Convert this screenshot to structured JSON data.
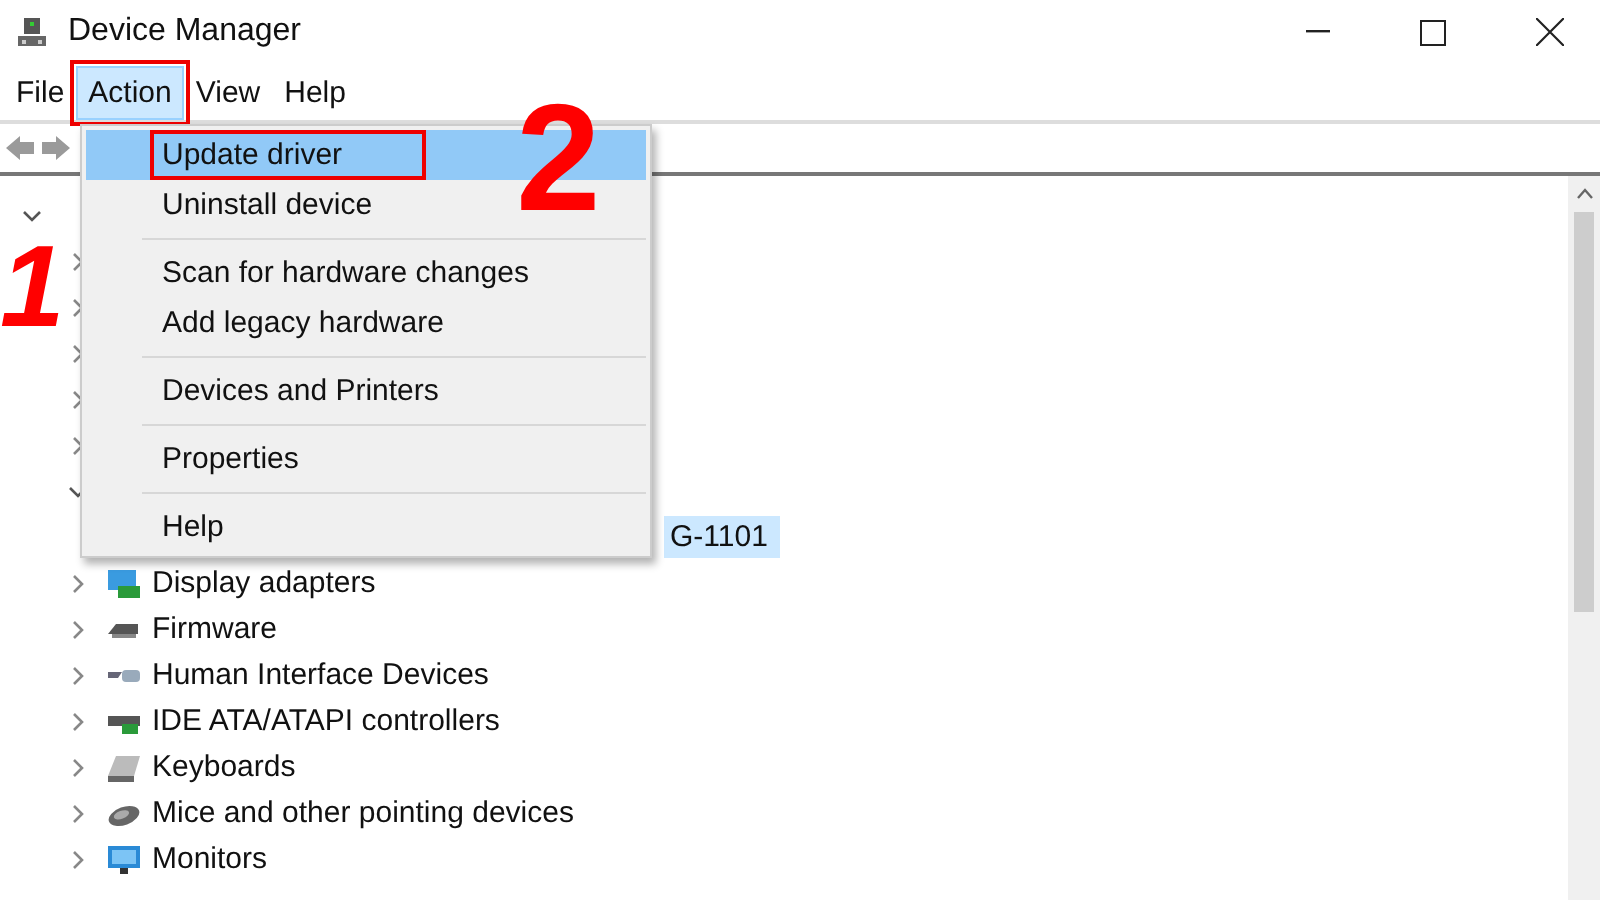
{
  "window": {
    "title": "Device Manager"
  },
  "menu_bar": [
    {
      "label": "File",
      "selected": false,
      "annotated": false
    },
    {
      "label": "Action",
      "selected": true,
      "annotated": true
    },
    {
      "label": "View",
      "selected": false,
      "annotated": false
    },
    {
      "label": "Help",
      "selected": false,
      "annotated": false
    }
  ],
  "context_menu": {
    "items": [
      {
        "kind": "item",
        "label": "Update driver",
        "selected": true,
        "annotated": true
      },
      {
        "kind": "item",
        "label": "Uninstall device",
        "selected": false,
        "annotated": false
      },
      {
        "kind": "separator"
      },
      {
        "kind": "item",
        "label": "Scan for hardware changes",
        "selected": false,
        "annotated": false
      },
      {
        "kind": "item",
        "label": "Add legacy hardware",
        "selected": false,
        "annotated": false
      },
      {
        "kind": "separator"
      },
      {
        "kind": "item",
        "label": "Devices and Printers",
        "selected": false,
        "annotated": false
      },
      {
        "kind": "separator"
      },
      {
        "kind": "item",
        "label": "Properties",
        "selected": false,
        "annotated": false
      },
      {
        "kind": "separator"
      },
      {
        "kind": "item",
        "label": "Help",
        "selected": false,
        "annotated": false
      }
    ]
  },
  "tree": {
    "items": [
      {
        "expanded": true,
        "children": [
          {
            "expanded": false
          },
          {
            "expanded": false
          },
          {
            "expanded": false
          },
          {
            "expanded": false
          },
          {
            "expanded": false
          },
          {
            "expanded": true,
            "children": [
              {
                "label": "G-1101",
                "selected": true
              }
            ]
          },
          {
            "label": "Display adapters",
            "expanded": false,
            "selected": false
          },
          {
            "label": "Firmware",
            "expanded": false,
            "selected": false
          },
          {
            "label": "Human Interface Devices",
            "expanded": false,
            "selected": false
          },
          {
            "label": "IDE ATA/ATAPI controllers",
            "expanded": false,
            "selected": false
          },
          {
            "label": "Keyboards",
            "expanded": false,
            "selected": false
          },
          {
            "label": "Mice and other pointing devices",
            "expanded": false,
            "selected": false
          },
          {
            "label": "Monitors",
            "expanded": false,
            "selected": false
          }
        ]
      }
    ]
  },
  "annotations": [
    {
      "label": "1"
    },
    {
      "label": "2"
    }
  ]
}
